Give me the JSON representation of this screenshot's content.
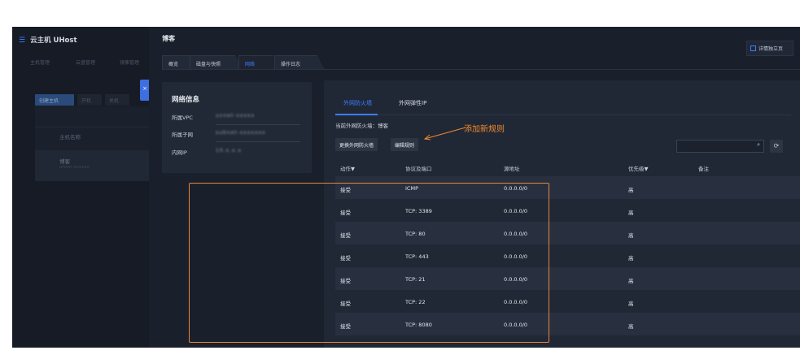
{
  "left_console": {
    "app_title": "云主机 UHost",
    "nav_items": [
      "主机管理",
      "云盘管理",
      "镜像管理"
    ],
    "action_buttons": [
      "创建主机",
      "开机",
      "关机"
    ],
    "list_header": "主机名称",
    "host_name": "博客",
    "host_sub": "uhost-xxxxxx"
  },
  "close_tab": {
    "icon": "×"
  },
  "main": {
    "title": "博客",
    "detail_button": "详情独立页",
    "tabs": [
      "概览",
      "磁盘与快照",
      "网络",
      "操作日志"
    ],
    "active_tab_index": 2
  },
  "network_info": {
    "heading": "网络信息",
    "rows": [
      {
        "label": "所属VPC",
        "value": "uvnet-xxxxx"
      },
      {
        "label": "所属子网",
        "value": "subnet-xxxxxxx"
      },
      {
        "label": "内网IP",
        "value": "10.x.x.x"
      }
    ]
  },
  "firewall": {
    "tabs": [
      "外网防火墙",
      "外网弹性IP"
    ],
    "active_tab_index": 0,
    "current_label": "当前外网防火墙：博客",
    "buttons": [
      "更换外网防火墙",
      "编辑规则"
    ],
    "annotation": "添加新规则",
    "search": {
      "placeholder": "",
      "icon": "search-icon"
    },
    "refresh_icon": "refresh-icon",
    "columns": [
      "动作▼",
      "协议及端口",
      "源地址",
      "优先级▼",
      "备注"
    ],
    "rows": [
      {
        "action": "接受",
        "protocol": "ICMP",
        "source": "0.0.0.0/0",
        "priority": "高",
        "note": ""
      },
      {
        "action": "接受",
        "protocol": "TCP: 3389",
        "source": "0.0.0.0/0",
        "priority": "高",
        "note": ""
      },
      {
        "action": "接受",
        "protocol": "TCP: 80",
        "source": "0.0.0.0/0",
        "priority": "高",
        "note": ""
      },
      {
        "action": "接受",
        "protocol": "TCP: 443",
        "source": "0.0.0.0/0",
        "priority": "高",
        "note": ""
      },
      {
        "action": "接受",
        "protocol": "TCP: 21",
        "source": "0.0.0.0/0",
        "priority": "高",
        "note": ""
      },
      {
        "action": "接受",
        "protocol": "TCP: 22",
        "source": "0.0.0.0/0",
        "priority": "高",
        "note": ""
      },
      {
        "action": "接受",
        "protocol": "TCP: 8080",
        "source": "0.0.0.0/0",
        "priority": "高",
        "note": ""
      }
    ]
  },
  "colors": {
    "accent": "#3f7dff",
    "highlight": "#e8843a",
    "panel": "#202735",
    "background": "#1a202b"
  }
}
